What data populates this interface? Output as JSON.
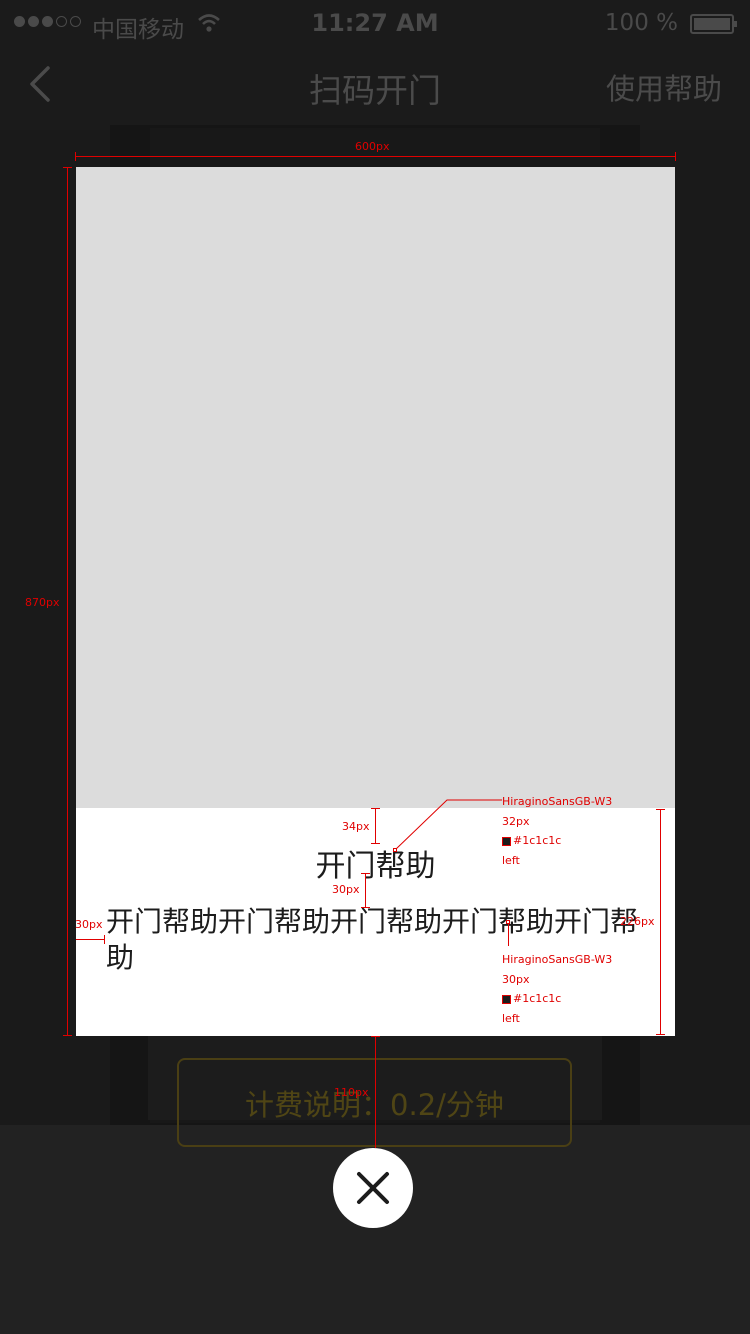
{
  "status_bar": {
    "carrier": "中国移动",
    "time": "11:27 AM",
    "battery": "100 %"
  },
  "nav": {
    "title": "扫码开门",
    "help": "使用帮助"
  },
  "fee_button": {
    "label": "计费说明：0.2/分钟"
  },
  "modal": {
    "title": "开门帮助",
    "body": "开门帮助开门帮助开门帮助开门帮助开门帮助"
  },
  "annotations": {
    "width_label": "600px",
    "height_label": "870px",
    "pad_top_label": "34px",
    "gap_label": "30px",
    "pad_left_label": "30px",
    "text_area_height_label": "226px",
    "bottom_gap_label": "110px",
    "title_spec": {
      "font": "HiraginoSansGB-W3",
      "size": "32px",
      "color": "#1c1c1c",
      "align": "left"
    },
    "body_spec": {
      "font": "HiraginoSansGB-W3",
      "size": "30px",
      "color": "#1c1c1c",
      "align": "left"
    }
  },
  "icons": {
    "back": "back-chevron-icon",
    "close": "close-icon",
    "wifi": "wifi-icon"
  },
  "colors": {
    "text_dark": "#1c1c1c",
    "annotation_red": "#e00000",
    "image_placeholder": "#dcdcdc",
    "fee_gold": "#4f4515"
  }
}
